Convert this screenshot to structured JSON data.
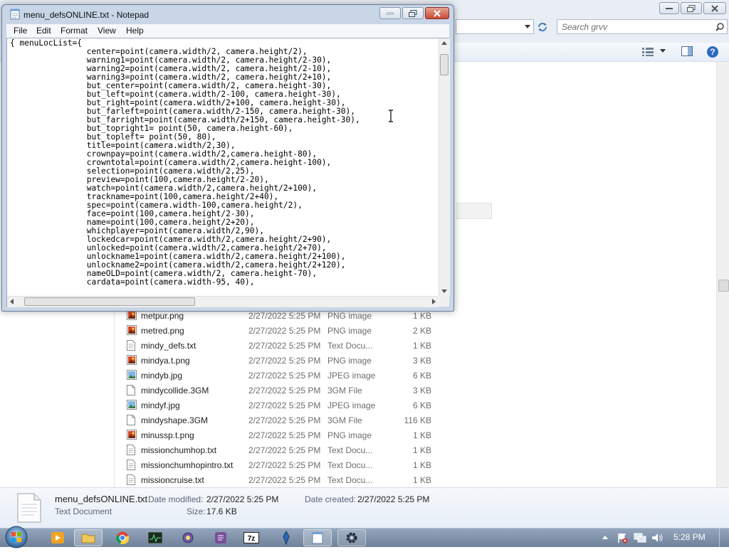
{
  "explorer": {
    "search_placeholder": "Search grvv",
    "files": [
      {
        "name": "metpur.png",
        "date": "2/27/2022 5:25 PM",
        "type": "PNG image",
        "size": "1 KB",
        "icon": "png"
      },
      {
        "name": "metred.png",
        "date": "2/27/2022 5:25 PM",
        "type": "PNG image",
        "size": "2 KB",
        "icon": "png"
      },
      {
        "name": "mindy_defs.txt",
        "date": "2/27/2022 5:25 PM",
        "type": "Text Docu...",
        "size": "1 KB",
        "icon": "txt"
      },
      {
        "name": "mindya.t.png",
        "date": "2/27/2022 5:25 PM",
        "type": "PNG image",
        "size": "3 KB",
        "icon": "png"
      },
      {
        "name": "mindyb.jpg",
        "date": "2/27/2022 5:25 PM",
        "type": "JPEG image",
        "size": "6 KB",
        "icon": "jpg"
      },
      {
        "name": "mindycollide.3GM",
        "date": "2/27/2022 5:25 PM",
        "type": "3GM File",
        "size": "3 KB",
        "icon": "file"
      },
      {
        "name": "mindyf.jpg",
        "date": "2/27/2022 5:25 PM",
        "type": "JPEG image",
        "size": "6 KB",
        "icon": "jpg"
      },
      {
        "name": "mindyshape.3GM",
        "date": "2/27/2022 5:25 PM",
        "type": "3GM File",
        "size": "116 KB",
        "icon": "file"
      },
      {
        "name": "minussp.t.png",
        "date": "2/27/2022 5:25 PM",
        "type": "PNG image",
        "size": "1 KB",
        "icon": "png"
      },
      {
        "name": "missionchumhop.txt",
        "date": "2/27/2022 5:25 PM",
        "type": "Text Docu...",
        "size": "1 KB",
        "icon": "txt"
      },
      {
        "name": "missionchumhopintro.txt",
        "date": "2/27/2022 5:25 PM",
        "type": "Text Docu...",
        "size": "1 KB",
        "icon": "txt"
      },
      {
        "name": "missioncruise.txt",
        "date": "2/27/2022 5:25 PM",
        "type": "Text Docu...",
        "size": "1 KB",
        "icon": "txt"
      }
    ],
    "details": {
      "filename": "menu_defsONLINE.txt",
      "filetype": "Text Document",
      "date_modified_label": "Date modified:",
      "date_modified": "2/27/2022 5:25 PM",
      "date_created_label": "Date created:",
      "date_created": "2/27/2022 5:25 PM",
      "size_label": "Size:",
      "size": "17.6 KB"
    }
  },
  "notepad": {
    "title": "menu_defsONLINE.txt - Notepad",
    "menu": [
      "File",
      "Edit",
      "Format",
      "View",
      "Help"
    ],
    "text": "{ menuLocList={\n                center=point(camera.width/2, camera.height/2),\n                warning1=point(camera.width/2, camera.height/2-30),\n                warning2=point(camera.width/2, camera.height/2-10),\n                warning3=point(camera.width/2, camera.height/2+10),\n                but_center=point(camera.width/2, camera.height-30),\n                but_left=point(camera.width/2-100, camera.height-30),\n                but_right=point(camera.width/2+100, camera.height-30),\n                but_farleft=point(camera.width/2-150, camera.height-30),\n                but_farright=point(camera.width/2+150, camera.height-30),\n                but_topright1= point(50, camera.height-60),\n                but_topleft= point(50, 80),\n                title=point(camera.width/2,30),\n                crownpay=point(camera.width/2,camera.height-80),\n                crowntotal=point(camera.width/2,camera.height-100),\n                selection=point(camera.width/2,25),\n                preview=point(100,camera.height/2-20),\n                watch=point(camera.width/2,camera.height/2+100),\n                trackname=point(100,camera.height/2+40),\n                spec=point(camera.width-100,camera.height/2),\n                face=point(100,camera.height/2-30),\n                name=point(100,camera.height/2+20),\n                whichplayer=point(camera.width/2,90),\n                lockedcar=point(camera.width/2,camera.height/2+90),\n                unlocked=point(camera.width/2,camera.height/2+70),\n                unlockname1=point(camera.width/2,camera.height/2+100),\n                unlockname2=point(camera.width/2,camera.height/2+120),\n                nameOLD=point(camera.width/2, camera.height-70),\n                cardata=point(camera.width-95, 40),"
  },
  "taskbar": {
    "time": "5:28 PM"
  }
}
